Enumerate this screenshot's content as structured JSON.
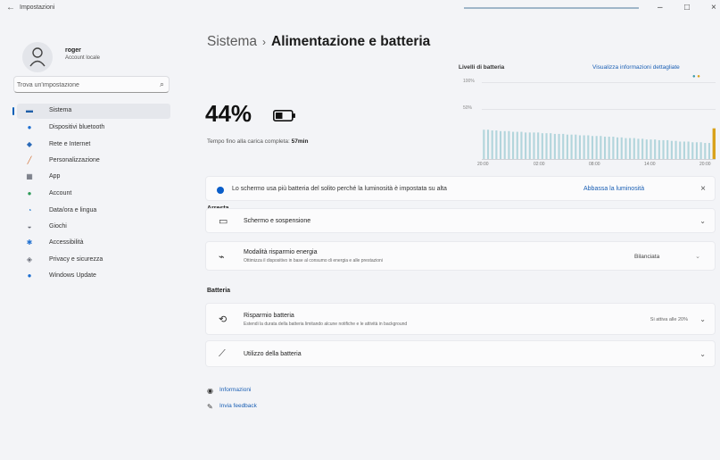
{
  "window": {
    "title": "Impostazioni",
    "back": "←",
    "minimize": "–",
    "maximize": "□",
    "close": "×"
  },
  "user": {
    "name": "roger",
    "account_type": "Account locale"
  },
  "search": {
    "placeholder": "Trova un'impostazione"
  },
  "nav": [
    {
      "label": "Sistema",
      "icon": "monitor-icon",
      "glyph": "▬",
      "color": "#1f5fa8",
      "active": true
    },
    {
      "label": "Dispositivi bluetooth",
      "icon": "bluetooth-icon",
      "glyph": "●",
      "color": "#1e6fd0",
      "active": false
    },
    {
      "label": "Rete e Internet",
      "icon": "wifi-icon",
      "glyph": "◆",
      "color": "#2a6ab8",
      "active": false
    },
    {
      "label": "Personalizzazione",
      "icon": "brush-icon",
      "glyph": "╱",
      "color": "#d06b2a",
      "active": false
    },
    {
      "label": "App",
      "icon": "apps-icon",
      "glyph": "▦",
      "color": "#555a66",
      "active": false
    },
    {
      "label": "Account",
      "icon": "account-icon",
      "glyph": "●",
      "color": "#2e9b58",
      "active": false
    },
    {
      "label": "Data/ora e lingua",
      "icon": "clock-globe-icon",
      "glyph": "◔",
      "color": "#2b7fd0",
      "active": false
    },
    {
      "label": "Giochi",
      "icon": "gamepad-icon",
      "glyph": "◒",
      "color": "#6a6e78",
      "active": false
    },
    {
      "label": "Accessibilità",
      "icon": "accessibility-icon",
      "glyph": "✱",
      "color": "#1e6fd0",
      "active": false
    },
    {
      "label": "Privacy e sicurezza",
      "icon": "shield-icon",
      "glyph": "◈",
      "color": "#6a6e78",
      "active": false
    },
    {
      "label": "Windows Update",
      "icon": "update-icon",
      "glyph": "●",
      "color": "#1e6fd0",
      "active": false
    }
  ],
  "breadcrumb": {
    "parent": "Sistema",
    "separator": "›",
    "current": "Alimentazione e batteria"
  },
  "battery": {
    "percent": "44%",
    "time_label": "Tempo fino alla carica completa:",
    "time_value": "57min",
    "level": 0.44
  },
  "chart_data": {
    "type": "bar",
    "title": "Livelli di batteria",
    "link": "Visualizza informazioni dettagliate",
    "y_ticks": [
      "100%",
      "50%"
    ],
    "x_ticks": [
      "20:00",
      "02:00",
      "08:00",
      "14:00",
      "20:00"
    ],
    "ylim": [
      0,
      100
    ],
    "series_colors": {
      "normal": "#3a9aa8",
      "charging": "#d9a21b"
    },
    "values": [
      42,
      42,
      41,
      41,
      40,
      40,
      40,
      39,
      39,
      39,
      38,
      38,
      38,
      38,
      37,
      37,
      37,
      36,
      36,
      36,
      35,
      35,
      35,
      34,
      34,
      34,
      33,
      33,
      33,
      32,
      32,
      32,
      31,
      31,
      30,
      30,
      30,
      29,
      29,
      28,
      28,
      28,
      27,
      27,
      27,
      26,
      26,
      25,
      25,
      25,
      24,
      24,
      24,
      23,
      23,
      44
    ],
    "charging_index": 55
  },
  "notice": {
    "text": "Lo schermo usa più batteria del solito perché la luminosità è impostata su alta",
    "action": "Abbassa la luminosità",
    "close": "×"
  },
  "sections": {
    "arresta": "Arresta",
    "batteria": "Batteria"
  },
  "cards": {
    "screen_sleep": {
      "title": "Schermo e sospensione"
    },
    "power_mode": {
      "title": "Modalità risparmio energia",
      "subtitle": "Ottimizza il dispositivo in base al consumo di energia e alle prestazioni",
      "value": "Bilanciata"
    },
    "battery_saver": {
      "title": "Risparmio batteria",
      "subtitle": "Estendi la durata della batteria limitando alcune notifiche e le attività in background",
      "status": "Si attiva alle 20%"
    },
    "battery_usage": {
      "title": "Utilizzo della batteria"
    }
  },
  "links": {
    "info": "Informazioni",
    "feedback": "Invia feedback"
  }
}
